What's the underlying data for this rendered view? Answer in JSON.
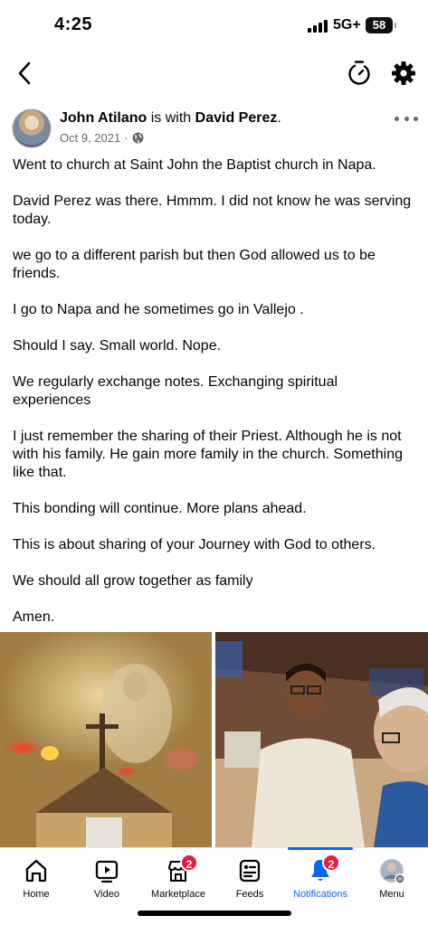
{
  "status": {
    "time": "4:25",
    "network": "5G+",
    "battery": "58"
  },
  "nav": {},
  "post": {
    "author": "John Atilano",
    "with_text": " is with ",
    "tagged": "David Perez",
    "period": ".",
    "date": "Oct 9, 2021",
    "separator": "·",
    "paragraphs": [
      "Went to church at Saint John the Baptist church in Napa.",
      "David Perez was there. Hmmm. I did not know he was serving today.",
      "we go to a different parish but then God allowed us to be friends.",
      "I go to Napa and he sometimes go in Vallejo .",
      "Should I say. Small world. Nope.",
      "We regularly exchange notes. Exchanging spiritual experiences",
      "I just remember the sharing of their Priest. Although he is not with his family. He gain more family in the church. Something like that.",
      "This bonding will continue.  More plans ahead.",
      "This is about sharing of your Journey with God to others.",
      "We should all grow together as family",
      "Amen."
    ]
  },
  "tabs": [
    {
      "label": "Home",
      "icon": "home-icon"
    },
    {
      "label": "Video",
      "icon": "video-icon"
    },
    {
      "label": "Marketplace",
      "icon": "marketplace-icon",
      "badge": "2"
    },
    {
      "label": "Feeds",
      "icon": "feeds-icon"
    },
    {
      "label": "Notifications",
      "icon": "bell-icon",
      "badge": "2",
      "active": true
    },
    {
      "label": "Menu",
      "icon": "profile-avatar-icon"
    }
  ],
  "colors": {
    "accent": "#0866ff",
    "badge": "#e41e3f",
    "meta": "#65676b"
  }
}
